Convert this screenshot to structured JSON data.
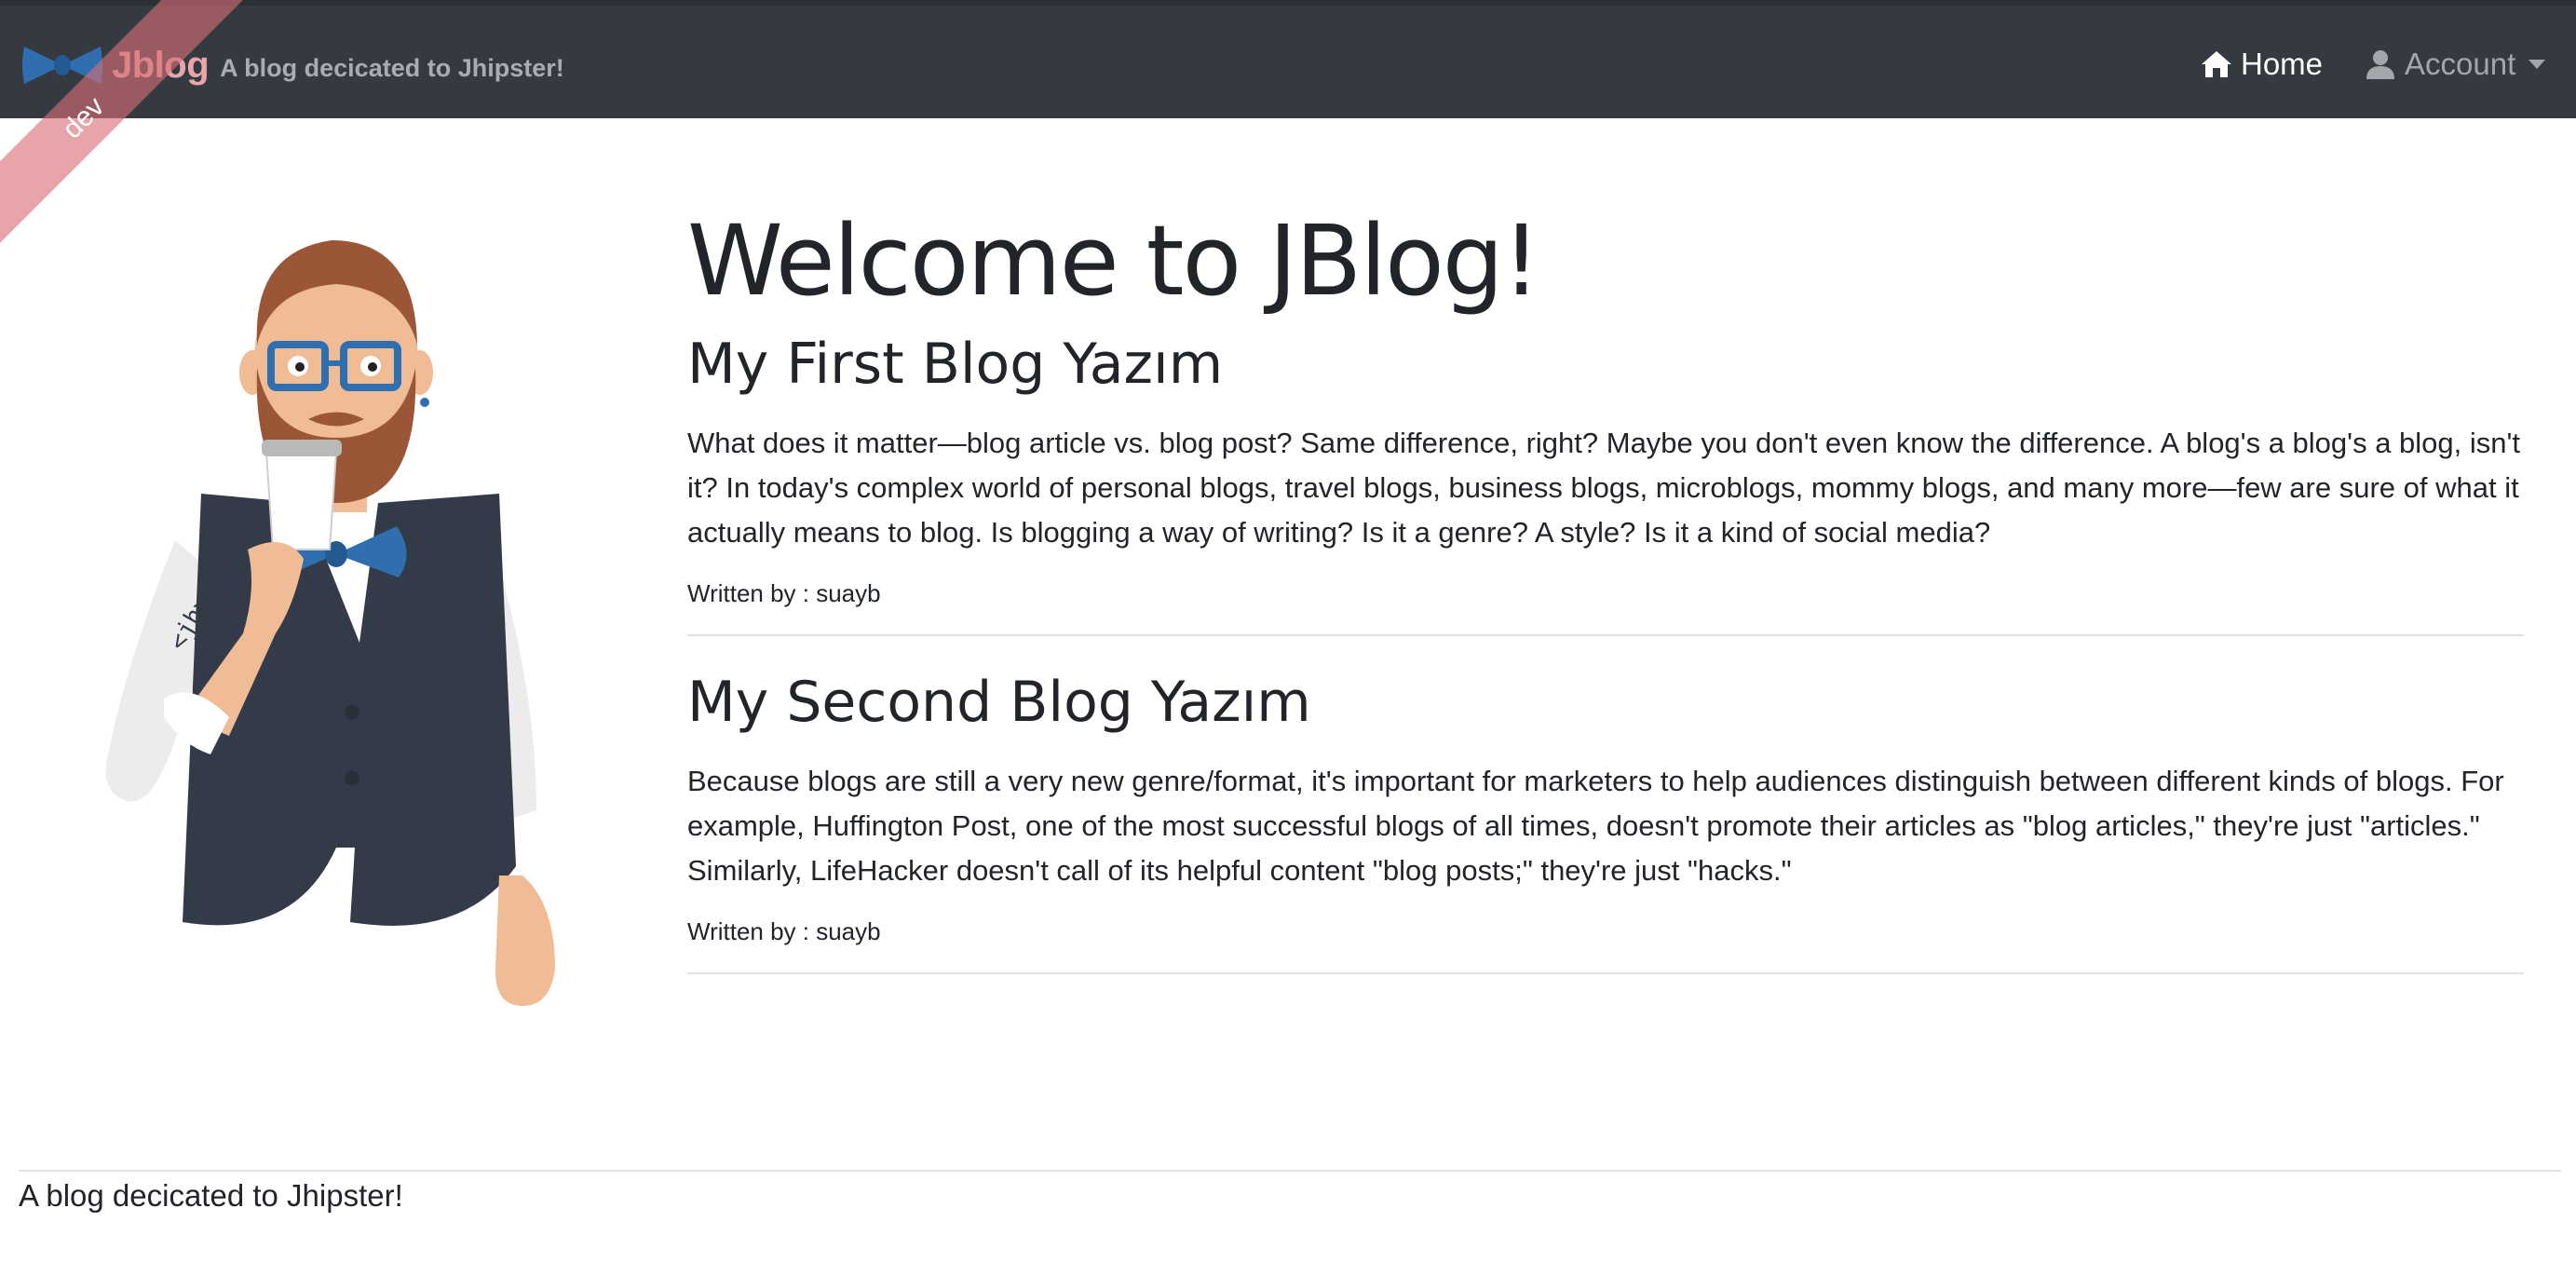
{
  "brand": {
    "name": "Jblog",
    "tagline": "A blog decicated to Jhipster!",
    "logo_icon": "bowtie-icon",
    "color": "#e8a6ab"
  },
  "ribbon": {
    "label": "dev"
  },
  "nav": {
    "home": {
      "label": "Home",
      "icon": "home-icon"
    },
    "account": {
      "label": "Account",
      "icon": "user-icon"
    }
  },
  "main": {
    "title": "Welcome to JBlog!",
    "posts": [
      {
        "title": "My First Blog Yazım",
        "content": "What does it matter—blog article vs. blog post? Same difference, right? Maybe you don't even know the difference. A blog's a blog's a blog, isn't it? In today's complex world of personal blogs, travel blogs, business blogs, microblogs, mommy blogs, and many more—few are sure of what it actually means to blog. Is blogging a way of writing? Is it a genre? A style? Is it a kind of social media?",
        "author": "Written by : suayb"
      },
      {
        "title": "My Second Blog Yazım",
        "content": "Because blogs are still a very new genre/format, it's important for marketers to help audiences distinguish between different kinds of blogs. For example, Huffington Post, one of the most successful blogs of all times, doesn't promote their articles as \"blog articles,\" they're just \"articles.\" Similarly, LifeHacker doesn't call of its helpful content \"blog posts;\" they're just \"hacks.\"",
        "author": "Written by : suayb"
      }
    ]
  },
  "footer": {
    "text": "A blog decicated to Jhipster!"
  },
  "colors": {
    "navbar": "#343a40",
    "ribbon": "#d96e76",
    "text": "#212529"
  }
}
